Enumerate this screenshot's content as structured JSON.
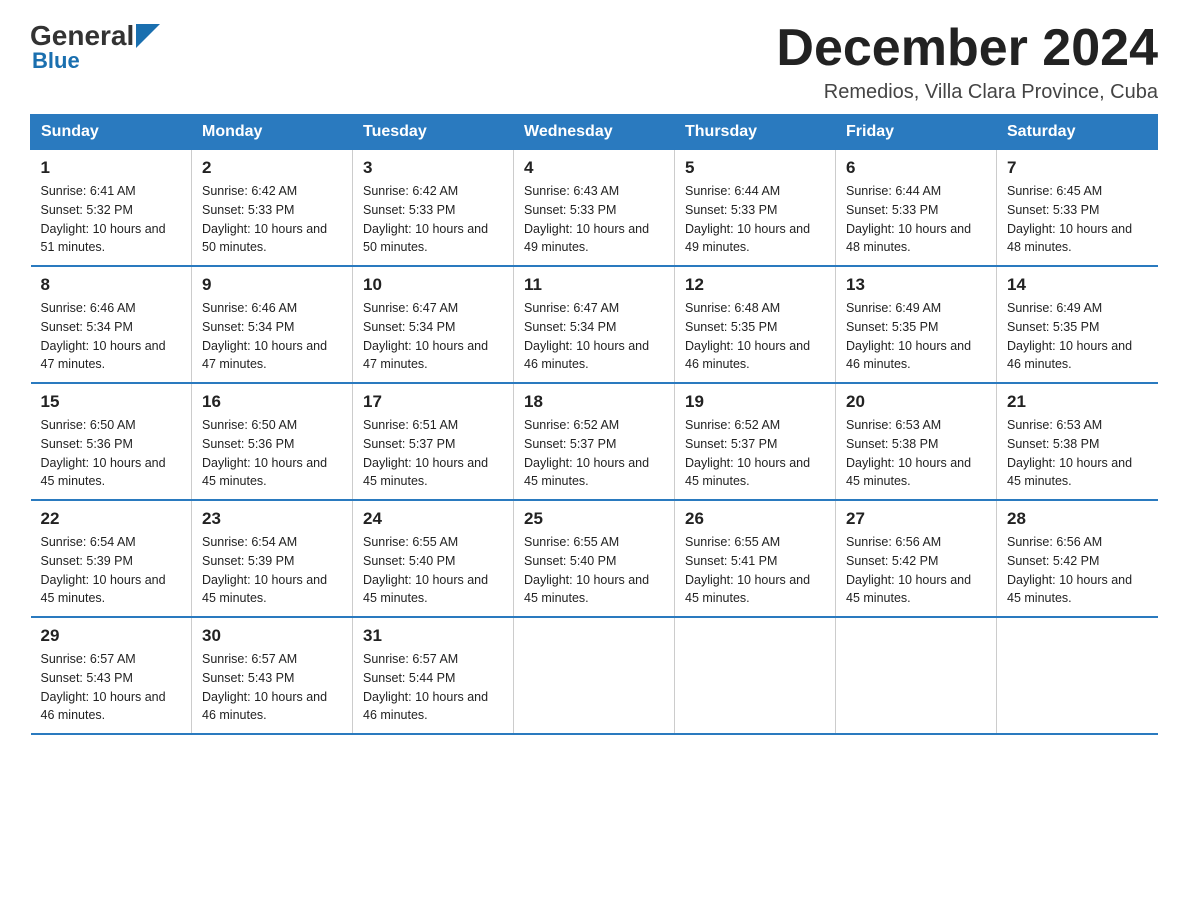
{
  "header": {
    "logo_general": "General",
    "logo_blue": "Blue",
    "month_title": "December 2024",
    "location": "Remedios, Villa Clara Province, Cuba"
  },
  "days_of_week": [
    "Sunday",
    "Monday",
    "Tuesday",
    "Wednesday",
    "Thursday",
    "Friday",
    "Saturday"
  ],
  "weeks": [
    [
      {
        "day": "1",
        "sunrise": "6:41 AM",
        "sunset": "5:32 PM",
        "daylight": "10 hours and 51 minutes."
      },
      {
        "day": "2",
        "sunrise": "6:42 AM",
        "sunset": "5:33 PM",
        "daylight": "10 hours and 50 minutes."
      },
      {
        "day": "3",
        "sunrise": "6:42 AM",
        "sunset": "5:33 PM",
        "daylight": "10 hours and 50 minutes."
      },
      {
        "day": "4",
        "sunrise": "6:43 AM",
        "sunset": "5:33 PM",
        "daylight": "10 hours and 49 minutes."
      },
      {
        "day": "5",
        "sunrise": "6:44 AM",
        "sunset": "5:33 PM",
        "daylight": "10 hours and 49 minutes."
      },
      {
        "day": "6",
        "sunrise": "6:44 AM",
        "sunset": "5:33 PM",
        "daylight": "10 hours and 48 minutes."
      },
      {
        "day": "7",
        "sunrise": "6:45 AM",
        "sunset": "5:33 PM",
        "daylight": "10 hours and 48 minutes."
      }
    ],
    [
      {
        "day": "8",
        "sunrise": "6:46 AM",
        "sunset": "5:34 PM",
        "daylight": "10 hours and 47 minutes."
      },
      {
        "day": "9",
        "sunrise": "6:46 AM",
        "sunset": "5:34 PM",
        "daylight": "10 hours and 47 minutes."
      },
      {
        "day": "10",
        "sunrise": "6:47 AM",
        "sunset": "5:34 PM",
        "daylight": "10 hours and 47 minutes."
      },
      {
        "day": "11",
        "sunrise": "6:47 AM",
        "sunset": "5:34 PM",
        "daylight": "10 hours and 46 minutes."
      },
      {
        "day": "12",
        "sunrise": "6:48 AM",
        "sunset": "5:35 PM",
        "daylight": "10 hours and 46 minutes."
      },
      {
        "day": "13",
        "sunrise": "6:49 AM",
        "sunset": "5:35 PM",
        "daylight": "10 hours and 46 minutes."
      },
      {
        "day": "14",
        "sunrise": "6:49 AM",
        "sunset": "5:35 PM",
        "daylight": "10 hours and 46 minutes."
      }
    ],
    [
      {
        "day": "15",
        "sunrise": "6:50 AM",
        "sunset": "5:36 PM",
        "daylight": "10 hours and 45 minutes."
      },
      {
        "day": "16",
        "sunrise": "6:50 AM",
        "sunset": "5:36 PM",
        "daylight": "10 hours and 45 minutes."
      },
      {
        "day": "17",
        "sunrise": "6:51 AM",
        "sunset": "5:37 PM",
        "daylight": "10 hours and 45 minutes."
      },
      {
        "day": "18",
        "sunrise": "6:52 AM",
        "sunset": "5:37 PM",
        "daylight": "10 hours and 45 minutes."
      },
      {
        "day": "19",
        "sunrise": "6:52 AM",
        "sunset": "5:37 PM",
        "daylight": "10 hours and 45 minutes."
      },
      {
        "day": "20",
        "sunrise": "6:53 AM",
        "sunset": "5:38 PM",
        "daylight": "10 hours and 45 minutes."
      },
      {
        "day": "21",
        "sunrise": "6:53 AM",
        "sunset": "5:38 PM",
        "daylight": "10 hours and 45 minutes."
      }
    ],
    [
      {
        "day": "22",
        "sunrise": "6:54 AM",
        "sunset": "5:39 PM",
        "daylight": "10 hours and 45 minutes."
      },
      {
        "day": "23",
        "sunrise": "6:54 AM",
        "sunset": "5:39 PM",
        "daylight": "10 hours and 45 minutes."
      },
      {
        "day": "24",
        "sunrise": "6:55 AM",
        "sunset": "5:40 PM",
        "daylight": "10 hours and 45 minutes."
      },
      {
        "day": "25",
        "sunrise": "6:55 AM",
        "sunset": "5:40 PM",
        "daylight": "10 hours and 45 minutes."
      },
      {
        "day": "26",
        "sunrise": "6:55 AM",
        "sunset": "5:41 PM",
        "daylight": "10 hours and 45 minutes."
      },
      {
        "day": "27",
        "sunrise": "6:56 AM",
        "sunset": "5:42 PM",
        "daylight": "10 hours and 45 minutes."
      },
      {
        "day": "28",
        "sunrise": "6:56 AM",
        "sunset": "5:42 PM",
        "daylight": "10 hours and 45 minutes."
      }
    ],
    [
      {
        "day": "29",
        "sunrise": "6:57 AM",
        "sunset": "5:43 PM",
        "daylight": "10 hours and 46 minutes."
      },
      {
        "day": "30",
        "sunrise": "6:57 AM",
        "sunset": "5:43 PM",
        "daylight": "10 hours and 46 minutes."
      },
      {
        "day": "31",
        "sunrise": "6:57 AM",
        "sunset": "5:44 PM",
        "daylight": "10 hours and 46 minutes."
      },
      null,
      null,
      null,
      null
    ]
  ]
}
